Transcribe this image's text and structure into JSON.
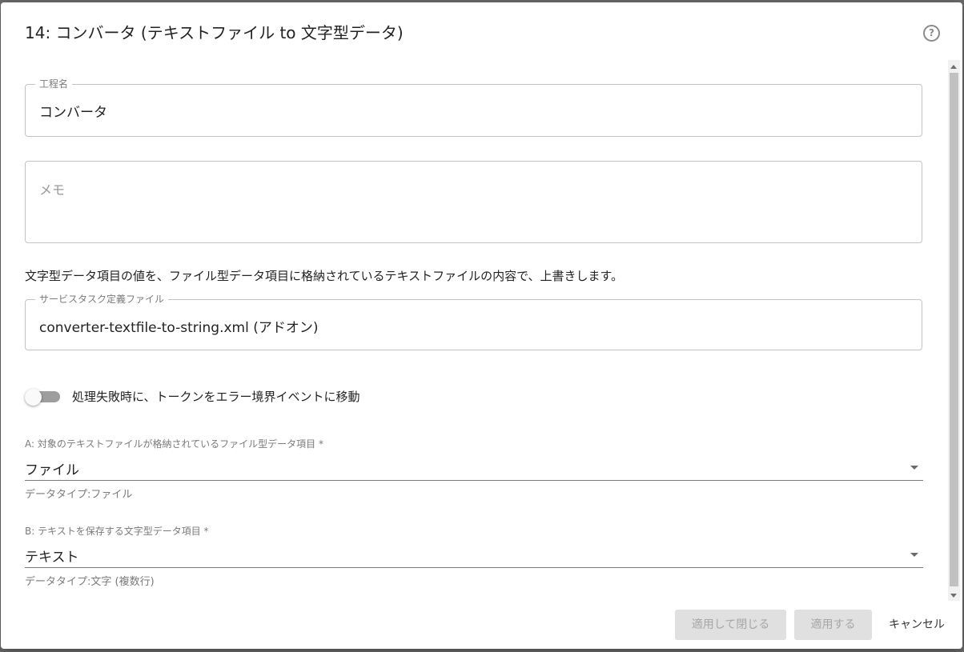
{
  "dialog": {
    "title": "14: コンバータ (テキストファイル to 文字型データ)",
    "help_icon": "question-circle-icon"
  },
  "step_name": {
    "label": "工程名",
    "value": "コンバータ"
  },
  "memo": {
    "placeholder": "メモ"
  },
  "description": "文字型データ項目の値を、ファイル型データ項目に格納されているテキストファイルの内容で、上書きします。",
  "service_task": {
    "label": "サービスタスク定義ファイル",
    "value": "converter-textfile-to-string.xml (アドオン)"
  },
  "error_toggle": {
    "label": "処理失敗時に、トークンをエラー境界イベントに移動",
    "checked": false
  },
  "field_a": {
    "label": "A: 対象のテキストファイルが格納されているファイル型データ項目 *",
    "value": "ファイル",
    "helper": "データタイプ:ファイル"
  },
  "field_b": {
    "label": "B: テキストを保存する文字型データ項目 *",
    "value": "テキスト",
    "helper": "データタイプ:文字 (複数行)"
  },
  "buttons": {
    "apply_close": "適用して閉じる",
    "apply": "適用する",
    "cancel": "キャンセル"
  }
}
